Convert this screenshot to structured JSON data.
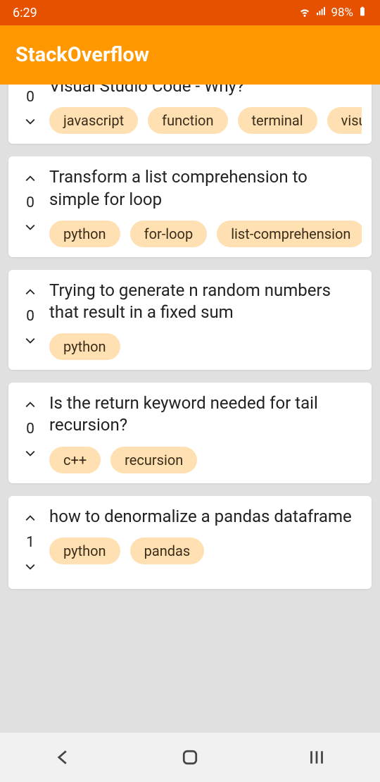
{
  "status": {
    "time": "6:29",
    "battery": "98%"
  },
  "app": {
    "title": "StackOverflow"
  },
  "questions": [
    {
      "score": "0",
      "title": "Not Logging Anything to the Terminal in Visual Studio Code - Why?",
      "tags": [
        "javascript",
        "function",
        "terminal",
        "visual"
      ],
      "partial": true
    },
    {
      "score": "0",
      "title": "Transform a list comprehension to simple for loop",
      "tags": [
        "python",
        "for-loop",
        "list-comprehension"
      ]
    },
    {
      "score": "0",
      "title": "Trying to generate n random numbers that result in a fixed sum",
      "tags": [
        "python"
      ]
    },
    {
      "score": "0",
      "title": "Is the return keyword needed for tail recursion?",
      "tags": [
        "c++",
        "recursion"
      ]
    },
    {
      "score": "1",
      "title": "how to denormalize a pandas dataframe",
      "tags": [
        "python",
        "pandas"
      ]
    }
  ]
}
